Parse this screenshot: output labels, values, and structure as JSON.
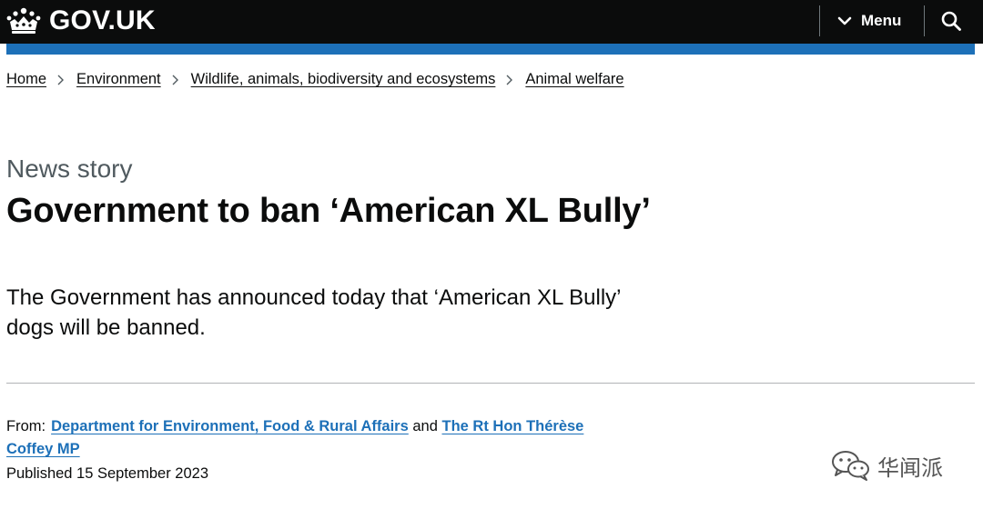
{
  "header": {
    "logo_text": "GOV.UK",
    "menu_label": "Menu"
  },
  "breadcrumbs": [
    "Home",
    "Environment",
    "Wildlife, animals, biodiversity and ecosystems",
    "Animal welfare"
  ],
  "page": {
    "caption": "News story",
    "title": "Government to ban ‘American XL Bully’",
    "lead": "The Government has announced today that ‘American XL Bully’ dogs will be banned."
  },
  "meta": {
    "from_label": "From:",
    "org_link": "Department for Environment, Food & Rural Affairs",
    "conjunction": "and",
    "person_link": "The Rt Hon Thérèse Coffey MP",
    "published": "Published 15 September 2023"
  },
  "watermark": {
    "text": "华闻派"
  },
  "colors": {
    "header_bg": "#0b0c0c",
    "accent_bar": "#1d70b8",
    "link": "#1d70b8",
    "caption": "#505a5f"
  },
  "icons": [
    "crown-icon",
    "chevron-down-icon",
    "search-icon",
    "chevron-right-icon",
    "wechat-icon"
  ]
}
